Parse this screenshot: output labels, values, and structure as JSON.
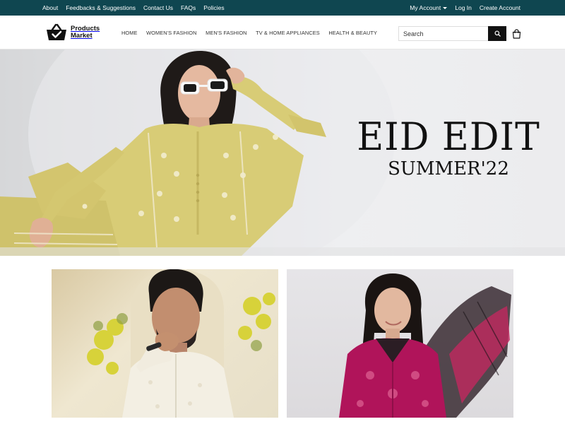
{
  "topbar": {
    "left_links": [
      "About",
      "Feedbacks & Suggestions",
      "Contact Us",
      "FAQs",
      "Policies"
    ],
    "my_account": "My Account",
    "login": "Log In",
    "create_account": "Create Account"
  },
  "brand": {
    "line1": "Products",
    "line2": "Market"
  },
  "nav": [
    "HOME",
    "WOMEN'S FASHION",
    "MEN'S FASHION",
    "TV & HOME APPLIANCES",
    "HEALTH & BEAUTY"
  ],
  "search": {
    "placeholder": "Search"
  },
  "hero": {
    "title": "EID EDIT",
    "subtitle": "SUMMER'22"
  },
  "icons": {
    "search": "search-icon",
    "cart": "shopping-bag-icon",
    "logo": "basket-check-icon",
    "account_caret": "caret-down-icon"
  },
  "colors": {
    "topbar": "#0f4650",
    "button": "#111111",
    "dress_yellow": "#d8cc76",
    "dress_magenta": "#b0145a"
  }
}
